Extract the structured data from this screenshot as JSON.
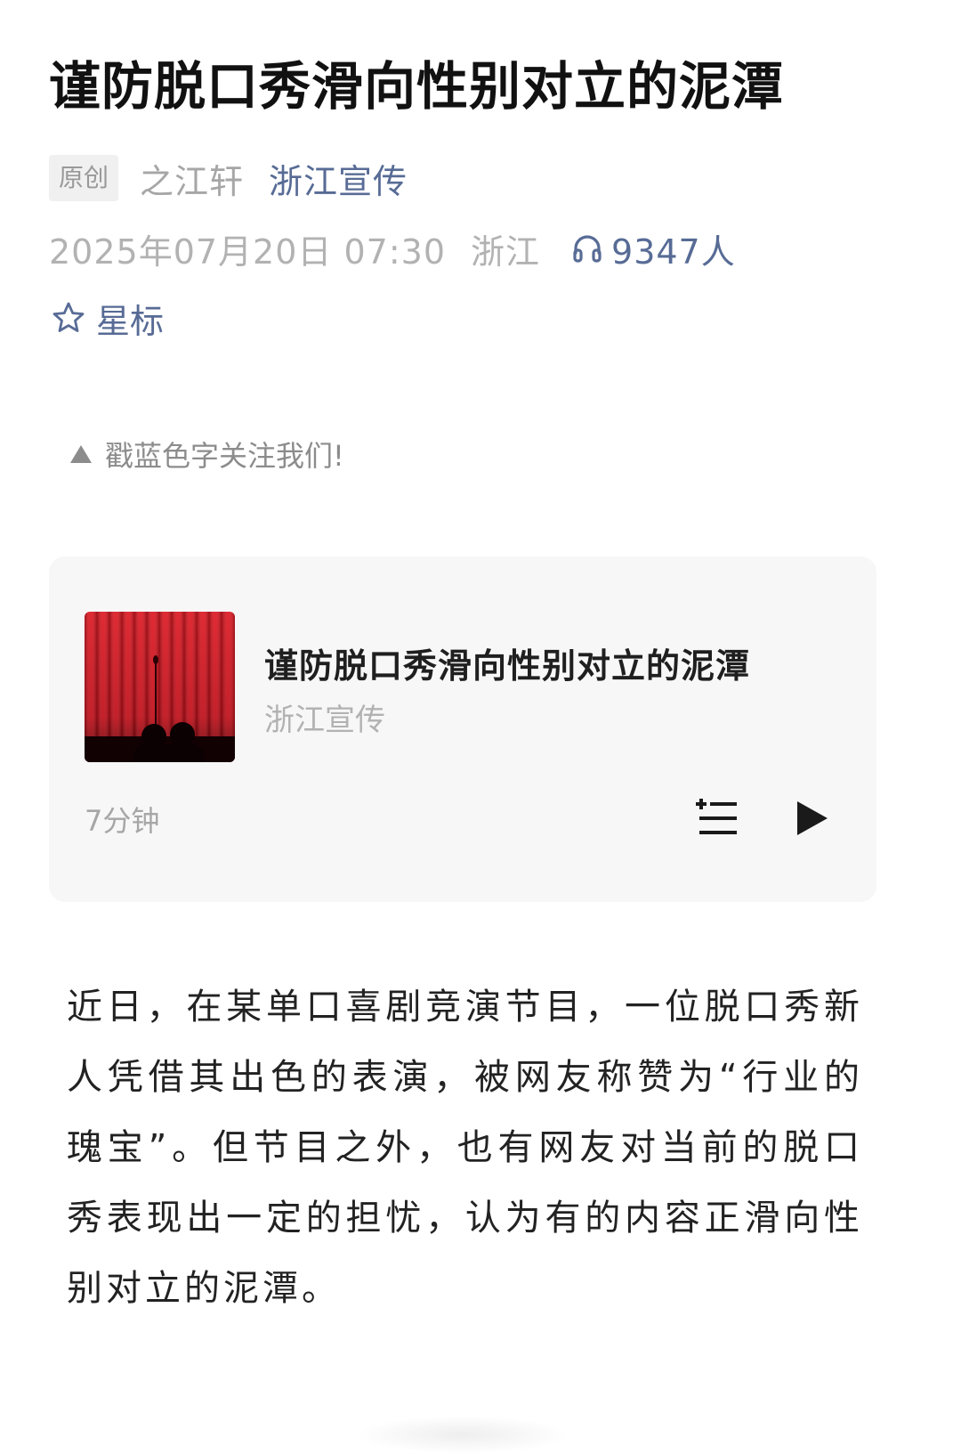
{
  "article": {
    "title": "谨防脱口秀滑向性别对立的泥潭",
    "badge": "原创",
    "author": "之江轩",
    "account": "浙江宣传",
    "date": "2025年07月20日 07:30",
    "location": "浙江",
    "listen_count": "9347人",
    "listen_icon": "headphones-icon",
    "star_label": "星标",
    "star_icon": "star-outline-icon"
  },
  "follow_tip": {
    "icon": "triangle-up-icon",
    "text": "戳蓝色字关注我们!"
  },
  "audio_card": {
    "title": "谨防脱口秀滑向性别对立的泥潭",
    "source": "浙江宣传",
    "duration": "7分钟",
    "playlist_icon": "add-to-playlist-icon",
    "play_icon": "play-icon"
  },
  "body": {
    "paragraph_1": "近日，在某单口喜剧竞演节目，一位脱口秀新人凭借其出色的表演，被网友称赞为“行业的瑰宝”。但节目之外，也有网友对当前的脱口秀表现出一定的担忧，认为有的内容正滑向性别对立的泥潭。"
  },
  "colors": {
    "link_blue": "#576b95",
    "meta_gray": "#b2b2b2",
    "card_bg": "#f7f7f7",
    "curtain_red": "#c8101c"
  }
}
